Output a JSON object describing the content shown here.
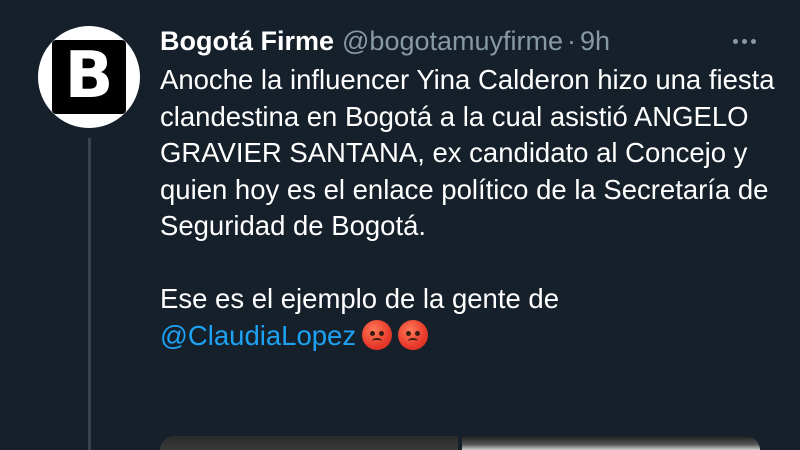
{
  "author": {
    "display_name": "Bogotá Firme",
    "handle": "@bogotamuyfirme",
    "separator": "·",
    "time": "9h",
    "avatar_letter": "B"
  },
  "tweet": {
    "paragraph1": "Anoche la influencer Yina Calderon hizo una fiesta clandestina en Bogotá a la cual asistió ANGELO GRAVIER SANTANA, ex candidato al Concejo y quien hoy es el enlace político de la Secretaría de Seguridad de Bogotá.",
    "paragraph2_text": "Ese es el ejemplo de la gente de",
    "mention": "@ClaudiaLopez",
    "emojis": [
      "pouting-face",
      "pouting-face"
    ]
  },
  "icons": {
    "more": "more-horizontal-icon",
    "emoji": "angry-face-emoji"
  },
  "colors": {
    "background": "#15202b",
    "text": "#ffffff",
    "secondary": "#8899a6",
    "link": "#1da1f2"
  }
}
